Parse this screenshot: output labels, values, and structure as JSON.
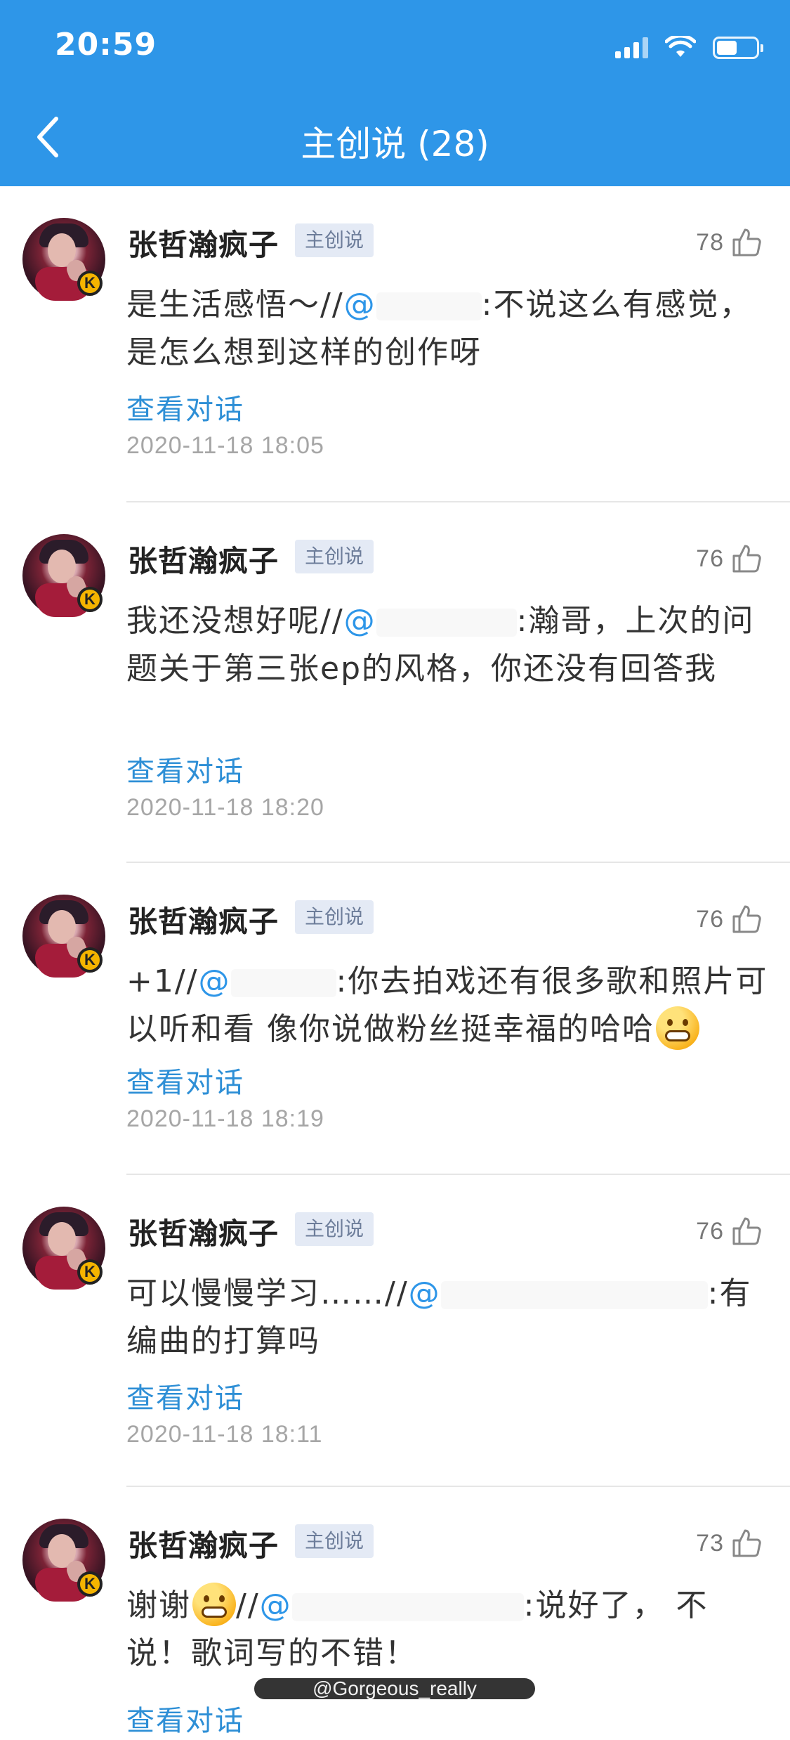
{
  "status_bar": {
    "time": "20:59"
  },
  "header": {
    "title": "主创说 (28)"
  },
  "colors": {
    "accent": "#2e96e8",
    "tag_bg": "#e4eaf5"
  },
  "comments": [
    {
      "user": "张哲瀚疯子",
      "tag": "主创说",
      "likes": "78",
      "text_before": "是生活感悟～//",
      "mention": "@",
      "text_after": ":不说这么有感觉，是怎么想到这样的创作呀",
      "view": "查看对话",
      "time": "2020-11-18 18:05"
    },
    {
      "user": "张哲瀚疯子",
      "tag": "主创说",
      "likes": "76",
      "text_before": "我还没想好呢//",
      "mention": "@",
      "text_after": ":瀚哥，上次的问题关于第三张ep的风格，你还没有回答我",
      "view": "查看对话",
      "time": "2020-11-18 18:20"
    },
    {
      "user": "张哲瀚疯子",
      "tag": "主创说",
      "likes": "76",
      "text_before": "+1//",
      "mention": "@",
      "text_after": ":你去拍戏还有很多歌和照片可以听和看 像你说做粉丝挺幸福的哈哈",
      "view": "查看对话",
      "time": "2020-11-18 18:19"
    },
    {
      "user": "张哲瀚疯子",
      "tag": "主创说",
      "likes": "76",
      "text_before": "可以慢慢学习……//",
      "mention": "@",
      "text_after": ":有编曲的打算吗",
      "view": "查看对话",
      "time": "2020-11-18 18:11"
    },
    {
      "user": "张哲瀚疯子",
      "tag": "主创说",
      "likes": "73",
      "text_before": "谢谢",
      "text_mid": "//",
      "mention": "@",
      "text_after": ":说好了， 不说！歌词写的不错！",
      "view": "查看对话"
    }
  ],
  "watermark": "@Gorgeous_really"
}
